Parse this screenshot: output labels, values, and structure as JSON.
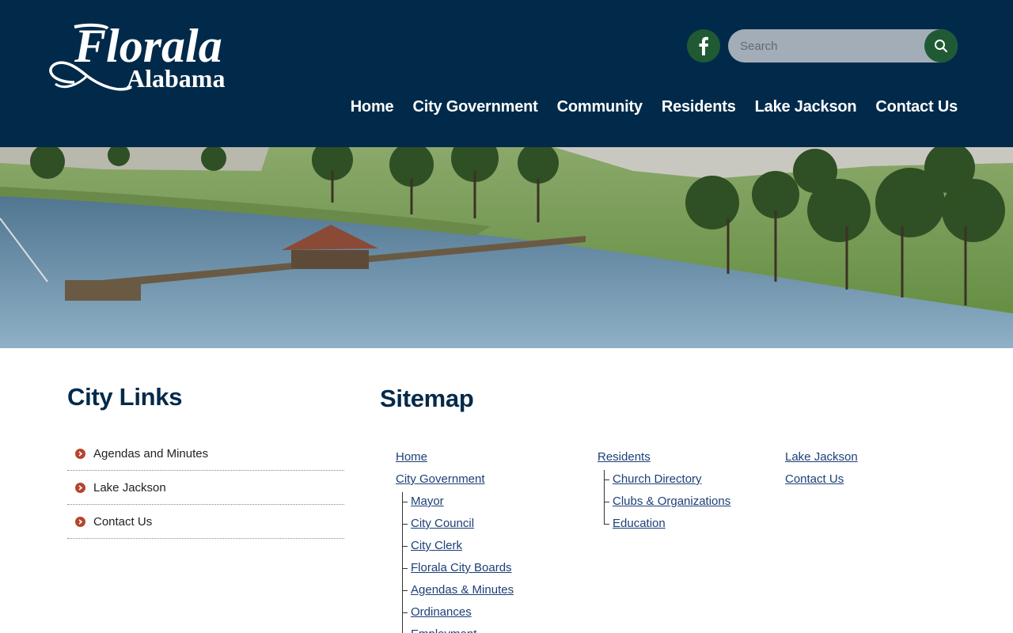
{
  "header": {
    "logo": {
      "line1": "Florala",
      "line2": "Alabama"
    },
    "facebook_icon": "facebook-icon",
    "search": {
      "placeholder": "Search",
      "value": "",
      "button_icon": "search-icon"
    },
    "nav": [
      {
        "label": "Home"
      },
      {
        "label": "City Government"
      },
      {
        "label": "Community"
      },
      {
        "label": "Residents"
      },
      {
        "label": "Lake Jackson"
      },
      {
        "label": "Contact Us"
      }
    ]
  },
  "banner": {
    "description_icon": "lake-pier-photo"
  },
  "sidebar": {
    "title": "City Links",
    "items": [
      {
        "label": "Agendas and Minutes"
      },
      {
        "label": "Lake Jackson"
      },
      {
        "label": "Contact Us"
      }
    ]
  },
  "main": {
    "title": "Sitemap",
    "columns": [
      {
        "links": [
          {
            "label": "Home",
            "child": false
          },
          {
            "label": "City Government",
            "child": false
          },
          {
            "label": "Mayor",
            "child": true
          },
          {
            "label": "City Council",
            "child": true
          },
          {
            "label": "City Clerk",
            "child": true
          },
          {
            "label": "Florala City Boards",
            "child": true
          },
          {
            "label": "Agendas & Minutes",
            "child": true
          },
          {
            "label": "Ordinances",
            "child": true
          },
          {
            "label": "Employment",
            "child": true
          }
        ]
      },
      {
        "links": [
          {
            "label": "Residents",
            "child": false
          },
          {
            "label": "Church Directory",
            "child": true
          },
          {
            "label": "Clubs & Organizations",
            "child": true
          },
          {
            "label": "Education",
            "child": true
          }
        ]
      },
      {
        "links": [
          {
            "label": "Lake Jackson",
            "child": false
          },
          {
            "label": "Contact Us",
            "child": false
          }
        ]
      }
    ]
  },
  "colors": {
    "header_bg": "#012a4a",
    "accent_green": "#1f5a35",
    "bullet_red": "#b5452e",
    "link_blue": "#1c3f78"
  }
}
